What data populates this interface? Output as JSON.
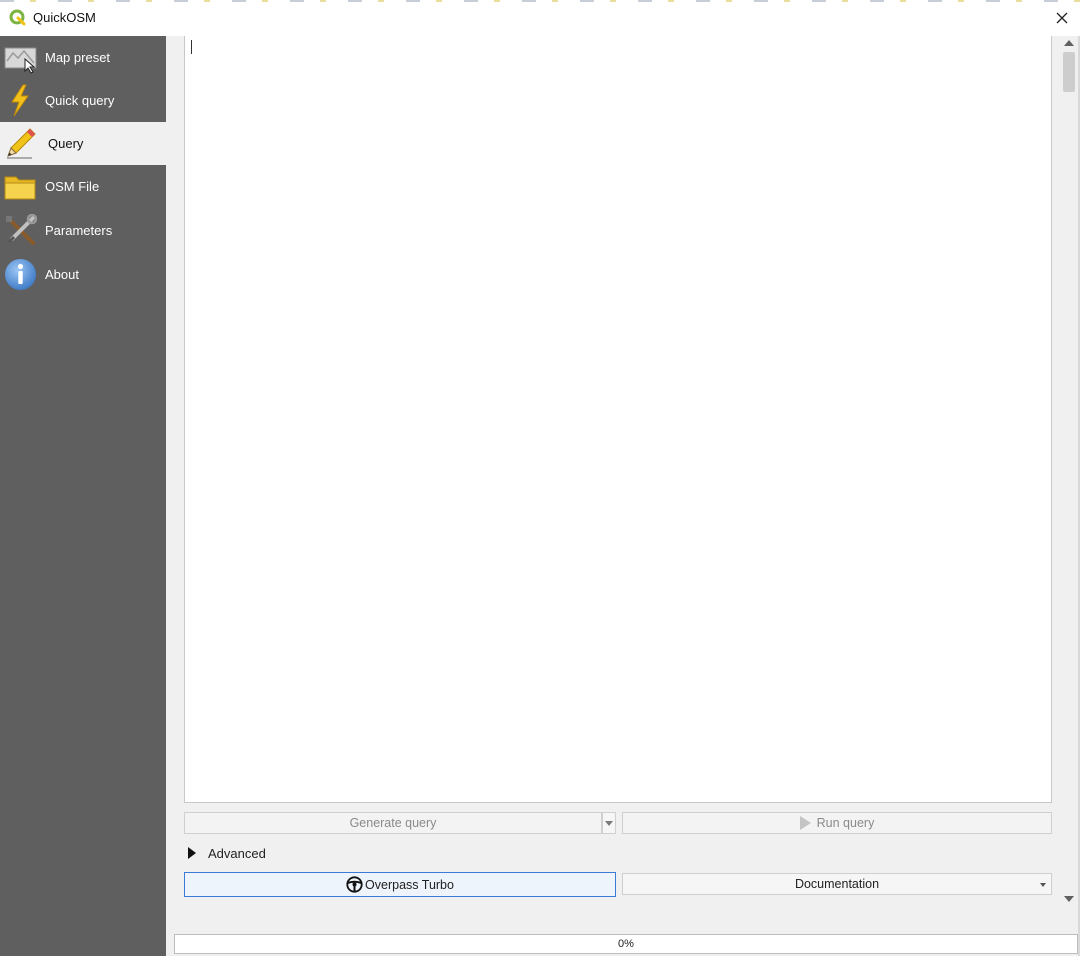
{
  "window": {
    "title": "QuickOSM",
    "icon": "qgis-logo-icon",
    "close_icon": "close-icon"
  },
  "sidebar": {
    "selected_index": 2,
    "items": [
      {
        "label": "Map preset",
        "icon": "map-icon"
      },
      {
        "label": "Quick query",
        "icon": "lightning-icon"
      },
      {
        "label": "Query",
        "icon": "pencil-icon"
      },
      {
        "label": "OSM File",
        "icon": "folder-icon"
      },
      {
        "label": "Parameters",
        "icon": "tools-icon"
      },
      {
        "label": "About",
        "icon": "info-icon"
      }
    ]
  },
  "query": {
    "editor_text": ""
  },
  "buttons": {
    "generate_query": "Generate query",
    "run_query": "Run query",
    "advanced": "Advanced",
    "overpass_turbo": "Overpass Turbo",
    "documentation": "Documentation"
  },
  "progress": {
    "value": 0,
    "label": "0%"
  },
  "colors": {
    "sidebar_bg": "#5f5f5f",
    "selected_item_bg": "#f0f0f0",
    "primary_border": "#3a7bd5",
    "progress_fill": "#06b025"
  }
}
